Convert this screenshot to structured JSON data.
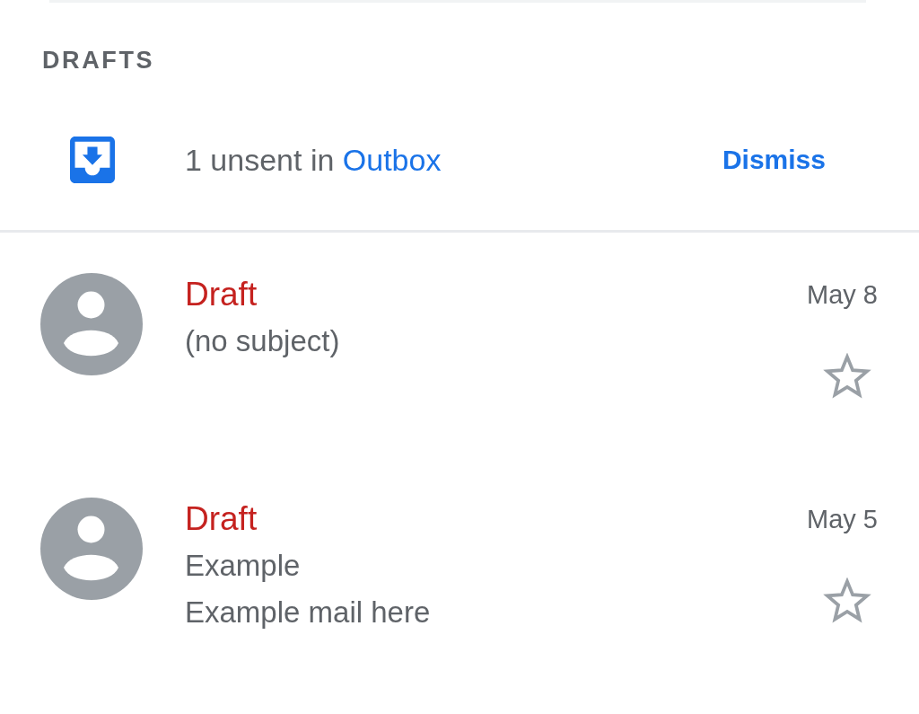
{
  "section_header": "DRAFTS",
  "outbox_banner": {
    "message": "1 unsent in",
    "link": "Outbox",
    "action": "Dismiss"
  },
  "drafts": [
    {
      "label": "Draft",
      "subject": "(no subject)",
      "date": "May 8",
      "starred": false
    },
    {
      "label": "Draft",
      "subject": "Example",
      "snippet": "Example mail here",
      "date": "May 5",
      "starred": false
    }
  ]
}
